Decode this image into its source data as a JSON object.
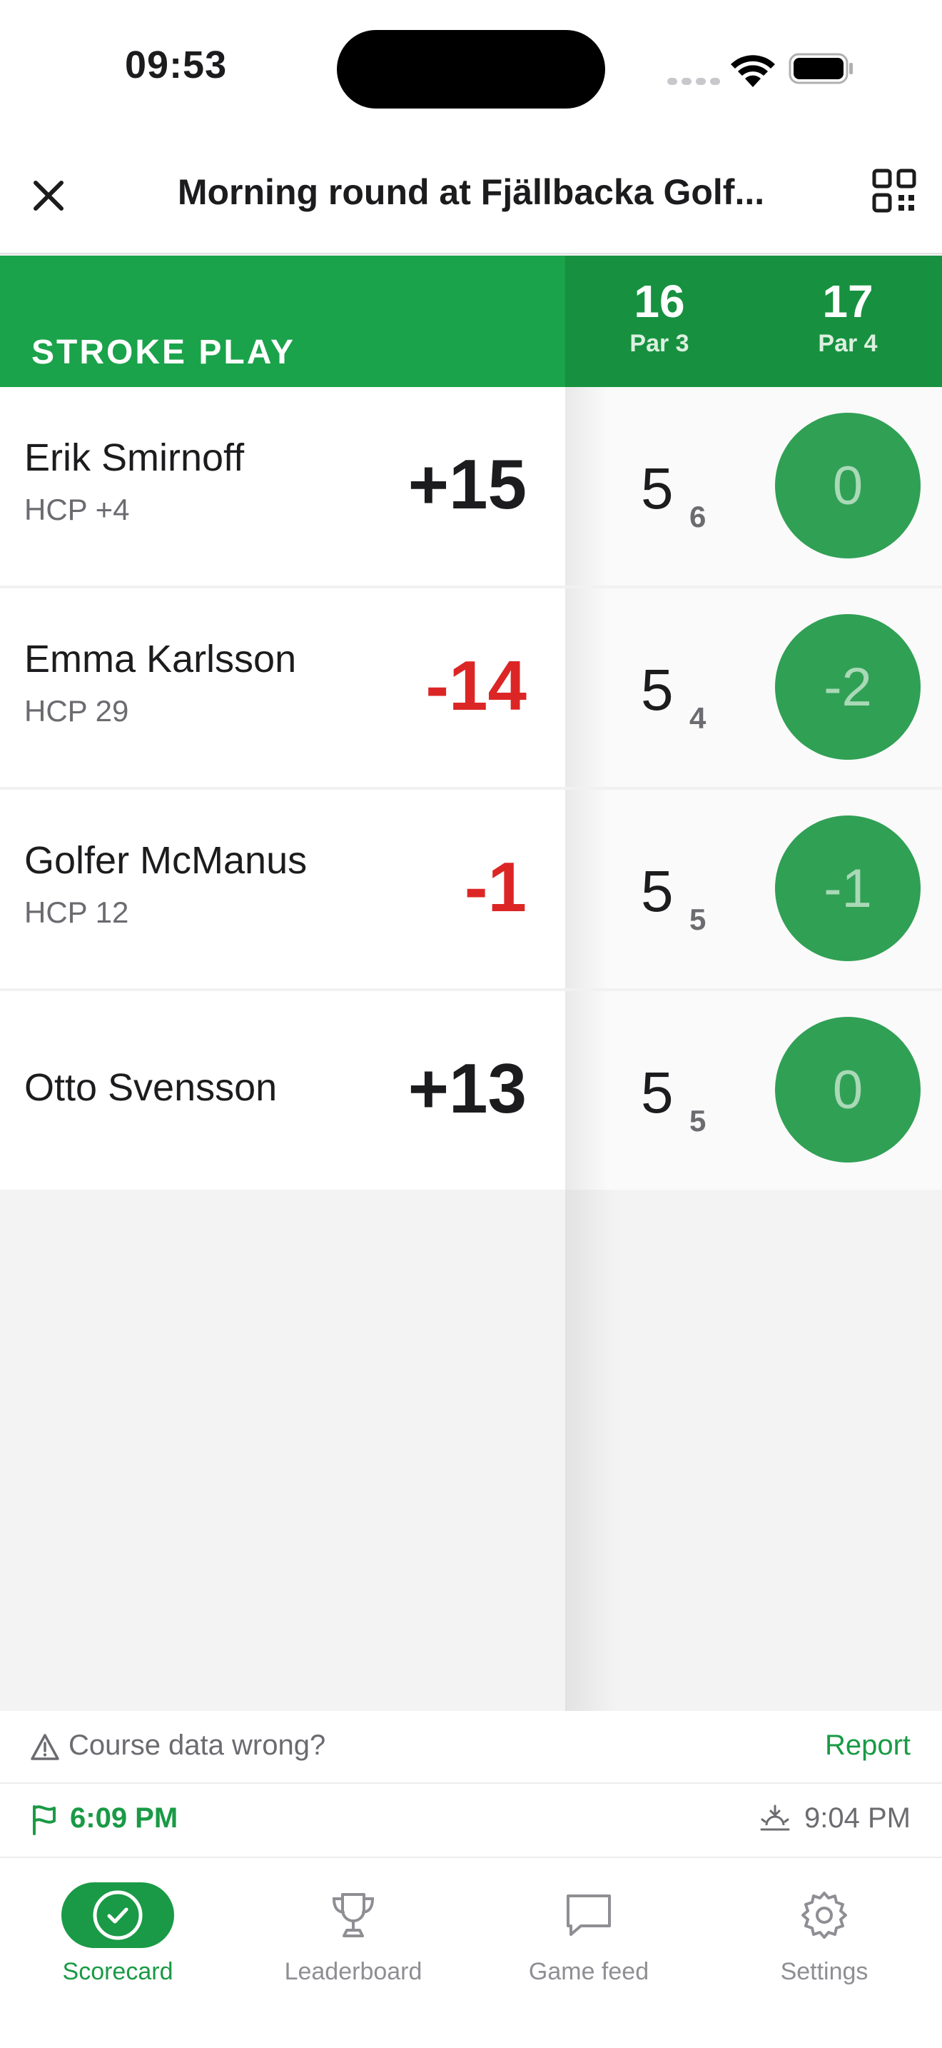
{
  "status_bar": {
    "time": "09:53"
  },
  "header": {
    "title": "Morning round at Fjällbacka Golf..."
  },
  "band": {
    "game_type": "STROKE PLAY",
    "holes": [
      {
        "number": "16",
        "par": "Par 3"
      },
      {
        "number": "17",
        "par": "Par 4"
      }
    ]
  },
  "players": [
    {
      "name": "Erik Smirnoff",
      "hcp": "HCP +4",
      "total": "+15",
      "strokes": "5",
      "net": "6",
      "hole17": "0"
    },
    {
      "name": "Emma Karlsson",
      "hcp": "HCP 29",
      "total": "-14",
      "strokes": "5",
      "net": "4",
      "hole17": "-2"
    },
    {
      "name": "Golfer McManus",
      "hcp": "HCP 12",
      "total": "-1",
      "strokes": "5",
      "net": "5",
      "hole17": "-1"
    },
    {
      "name": "Otto Svensson",
      "hcp": "",
      "total": "+13",
      "strokes": "5",
      "net": "5",
      "hole17": "0"
    }
  ],
  "footer": {
    "course_warning": "Course data wrong?",
    "report_label": "Report",
    "start_time": "6:09 PM",
    "sunset_time": "9:04 PM"
  },
  "tabs": [
    {
      "label": "Scorecard",
      "icon": "check-circle-icon",
      "active": true
    },
    {
      "label": "Leaderboard",
      "icon": "trophy-icon",
      "active": false
    },
    {
      "label": "Game feed",
      "icon": "chat-bubble-icon",
      "active": false
    },
    {
      "label": "Settings",
      "icon": "gear-icon",
      "active": false
    }
  ],
  "colors": {
    "brand_green": "#1aa34a",
    "circle_green": "#30a055",
    "negative_red": "#dc2626"
  }
}
